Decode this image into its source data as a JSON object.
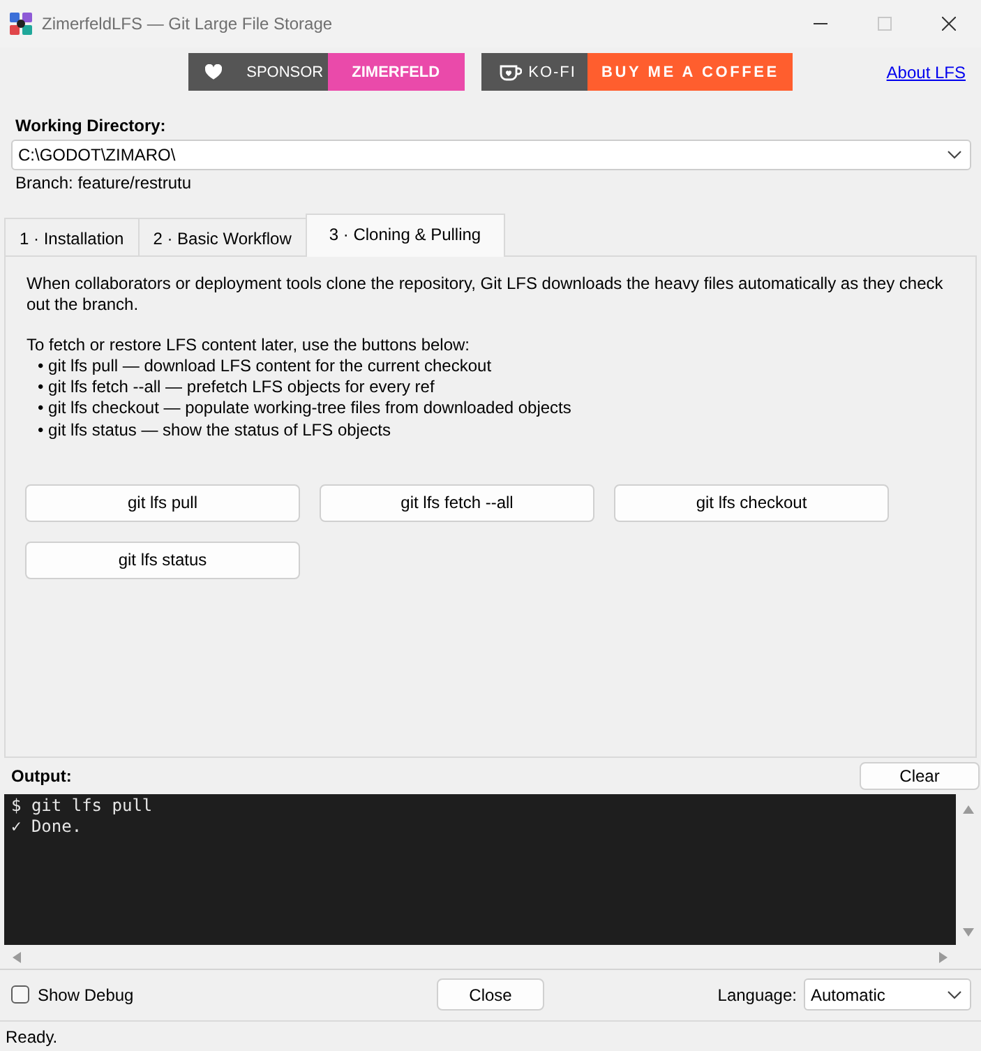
{
  "window": {
    "title": "ZimerfeldLFS — Git Large File Storage",
    "controls": [
      {
        "kind": "minimize",
        "disabled": false
      },
      {
        "kind": "maximize",
        "disabled": true
      },
      {
        "kind": "close",
        "disabled": false
      }
    ]
  },
  "header": {
    "badges": [
      {
        "kind": "sponsor",
        "label": "SPONSOR",
        "value": "ZIMERFELD",
        "color": "#ea4aaa"
      },
      {
        "kind": "kofi",
        "label": "KO-FI",
        "value": "BUY ME A COFFEE",
        "color": "#ff5e2e"
      }
    ],
    "link": "About LFS"
  },
  "working_directory": {
    "label": "Working Directory:",
    "value": "C:\\GODOT\\ZIMARO\\",
    "branch": "Branch: feature/restrutu"
  },
  "tabs": [
    {
      "label": "1 · Installation",
      "selected": false
    },
    {
      "label": "2 · Basic Workflow",
      "selected": false
    },
    {
      "label": "3 · Cloning & Pulling",
      "selected": true
    }
  ],
  "panel": {
    "paragraphs": [
      "When collaborators or deployment tools clone the repository, Git LFS downloads the heavy files automatically as they check out the branch.",
      "To fetch or restore LFS content later, use the buttons below:"
    ],
    "bullets": [
      "• git lfs pull — download LFS content for the current checkout",
      "• git lfs fetch --all — prefetch LFS objects for every ref",
      "• git lfs checkout — populate working-tree files from downloaded objects",
      "• git lfs status — show the status of LFS objects"
    ],
    "buttons": [
      "git lfs pull",
      "git lfs fetch --all",
      "git lfs checkout",
      "git lfs status"
    ]
  },
  "output": {
    "label": "Output:",
    "clear": "Clear",
    "lines": [
      "$ git lfs pull",
      "✓ Done."
    ]
  },
  "footer": {
    "show_debug": {
      "label": "Show Debug",
      "checked": false
    },
    "close": "Close",
    "language": {
      "label": "Language:",
      "value": "Automatic"
    }
  },
  "status_bar": "Ready."
}
